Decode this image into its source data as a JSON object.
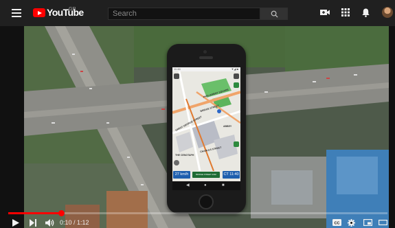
{
  "header": {
    "logo_text": "YouTube",
    "logo_region": "GR",
    "search_placeholder": "Search"
  },
  "icons": {
    "menu": "hamburger-menu-icon",
    "logo": "youtube-logo-icon",
    "search": "search-icon",
    "create": "video-camera-add-icon",
    "apps": "apps-grid-icon",
    "notifications": "bell-icon",
    "avatar": "user-avatar",
    "play": "play-icon",
    "next": "skip-next-icon",
    "volume": "volume-icon",
    "captions": "captions-icon",
    "settings": "gear-icon",
    "miniplayer": "miniplayer-icon",
    "theater": "theater-mode-icon"
  },
  "player": {
    "time_current": "0:10",
    "time_total": "1:12",
    "progress": 0.139,
    "time_display": "0:10 / 1:12",
    "captions_label": "CC"
  },
  "video_frame": {
    "phone_status_time": "11:46",
    "phone_status_icons": "▼◢ ■",
    "streets": [
      "PARLIAMENT SQUARE",
      "BRIDGE STREET",
      "GREAT GEORGE STREET",
      "THE CENOTAPH",
      "CHARLES STREET",
      "ABBEY"
    ],
    "speed": "27 km/h",
    "instruction": "BRIDGE STREET A302",
    "clock": "CT 11:40"
  },
  "colors": {
    "topbar": "#202020",
    "logo_red": "#ff0000",
    "progress_red": "#ff0000",
    "info_blue": "#1f5fae",
    "instruction_green": "#1e6b34"
  }
}
